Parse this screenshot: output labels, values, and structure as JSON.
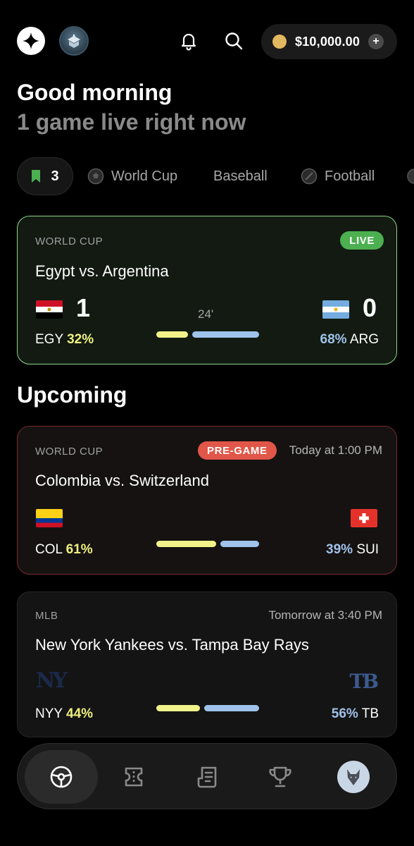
{
  "header": {
    "balance": "$10,000.00",
    "plus_label": "+"
  },
  "greeting": {
    "title": "Good morning",
    "subtitle": "1 game live right now"
  },
  "filters": {
    "saved_count": "3",
    "items": [
      "World Cup",
      "Baseball",
      "Football"
    ]
  },
  "live_game": {
    "league": "WORLD CUP",
    "badge": "LIVE",
    "title": "Egypt vs. Argentina",
    "minute": "24'",
    "home": {
      "code": "EGY",
      "score": "1",
      "pct": "32%",
      "pct_value": 0.32
    },
    "away": {
      "code": "ARG",
      "score": "0",
      "pct": "68%",
      "pct_value": 0.68
    }
  },
  "upcoming_heading": "Upcoming",
  "upcoming": [
    {
      "league": "WORLD CUP",
      "badge": "PRE-GAME",
      "time": "Today at 1:00 PM",
      "title": "Colombia vs. Switzerland",
      "home": {
        "code": "COL",
        "pct": "61%",
        "pct_value": 0.61
      },
      "away": {
        "code": "SUI",
        "pct": "39%",
        "pct_value": 0.39
      }
    },
    {
      "league": "MLB",
      "time": "Tomorrow at 3:40 PM",
      "title": "New York Yankees vs. Tampa Bay Rays",
      "home": {
        "code": "NYY",
        "pct": "44%",
        "pct_value": 0.44,
        "logo_text": "NY"
      },
      "away": {
        "code": "TB",
        "pct": "56%",
        "pct_value": 0.56,
        "logo_text": "TB"
      }
    }
  ],
  "colors": {
    "accent_green": "#4caf50",
    "live_border": "#8fd68a",
    "pregame_red": "#e05648",
    "home_bar": "#f1f28a",
    "away_bar": "#9fc3ea"
  },
  "icons": [
    "logo-icon",
    "app-avatar-icon",
    "bell-icon",
    "search-icon",
    "coin-icon",
    "bookmark-icon",
    "soccer-ball-icon",
    "football-icon",
    "ball-icon",
    "steering-icon",
    "ticket-icon",
    "news-icon",
    "trophy-icon",
    "profile-wolf-icon"
  ]
}
